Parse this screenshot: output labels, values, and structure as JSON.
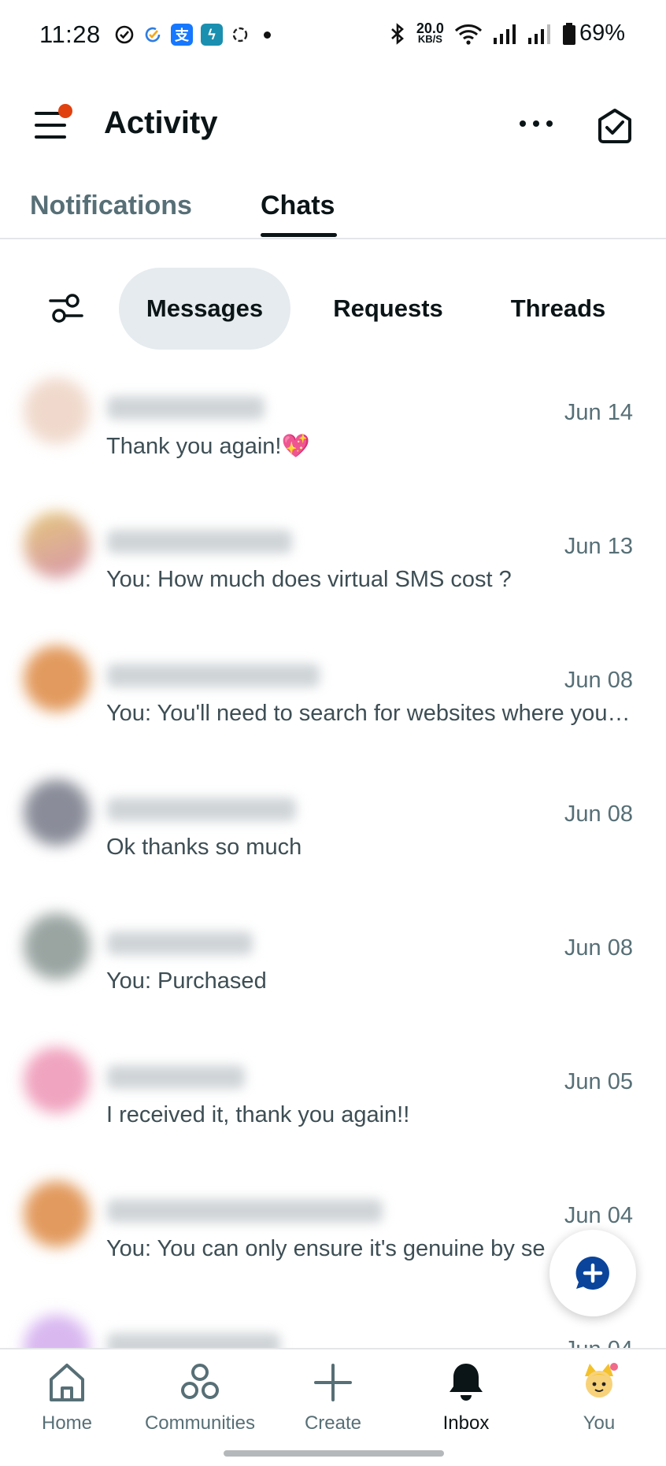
{
  "status_bar": {
    "time": "11:28",
    "net_speed_value": "20.0",
    "net_speed_unit": "KB/S",
    "battery": "69%"
  },
  "header": {
    "title": "Activity",
    "icons": [
      "menu-icon",
      "more-icon",
      "mark-read-icon"
    ]
  },
  "tabs": [
    {
      "label": "Notifications",
      "active": false
    },
    {
      "label": "Chats",
      "active": true
    }
  ],
  "filters": {
    "icon": "filter-icon",
    "chips": [
      {
        "label": "Messages",
        "selected": true
      },
      {
        "label": "Requests",
        "selected": false
      },
      {
        "label": "Threads",
        "selected": false
      }
    ]
  },
  "chats": [
    {
      "date": "Jun 14",
      "preview": "Thank you again!💖",
      "avatar_color": "#f0d9cc"
    },
    {
      "date": "Jun 13",
      "preview": "You: How much does virtual SMS cost ?",
      "avatar_color": "#e3c77b"
    },
    {
      "date": "Jun 08",
      "preview": "You: You'll need to search for websites where you can buy virtual numbers",
      "avatar_color": "#e29a5e"
    },
    {
      "date": "Jun 08",
      "preview": "Ok thanks so much",
      "avatar_color": "#8a8d99"
    },
    {
      "date": "Jun 08",
      "preview": "You: Purchased",
      "avatar_color": "#9aa5a2"
    },
    {
      "date": "Jun 05",
      "preview": "I received it, thank you again!!",
      "avatar_color": "#f0a4bf"
    },
    {
      "date": "Jun 04",
      "preview": "You: You can only ensure it's genuine by se",
      "avatar_color": "#e29a5e"
    },
    {
      "date": "Jun 04",
      "preview": "",
      "avatar_color": "#d9b8f0"
    }
  ],
  "fab": {
    "icon": "new-chat-icon",
    "color": "#0a449b"
  },
  "bottom_nav": [
    {
      "label": "Home",
      "icon": "home-icon",
      "active": false
    },
    {
      "label": "Communities",
      "icon": "communities-icon",
      "active": false
    },
    {
      "label": "Create",
      "icon": "plus-icon",
      "active": false
    },
    {
      "label": "Inbox",
      "icon": "bell-icon",
      "active": true
    },
    {
      "label": "You",
      "icon": "avatar",
      "active": false
    }
  ],
  "colors": {
    "notification_dot": "#e0410f",
    "selected_chip_bg": "#e5ebee",
    "text_primary": "#0b1416",
    "text_secondary": "#576f76"
  }
}
